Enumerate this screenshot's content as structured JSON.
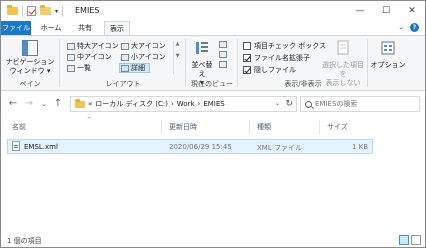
{
  "window": {
    "title": "EMIES",
    "qat_dropdown": "▾",
    "minimize": "—",
    "maximize": "☐",
    "close": "✕"
  },
  "tabs": {
    "file": "ファイル",
    "home": "ホーム",
    "share": "共有",
    "view": "表示",
    "collapse": "⌄",
    "help": "?"
  },
  "ribbon": {
    "panes": {
      "nav_pane_line1": "ナビゲーション",
      "nav_pane_line2": "ウィンドウ ▾",
      "label": "ペイン"
    },
    "layout": {
      "extra_large_icons": "特大アイコン",
      "large_icons": "大アイコン",
      "medium_icons": "中アイコン",
      "small_icons": "小アイコン",
      "list": "一覧",
      "details": "詳細",
      "label": "レイアウト"
    },
    "current_view": {
      "sort_by_line1": "並べ替え",
      "sort_by_line2": "▾",
      "label": "現在のビュー"
    },
    "show_hide": {
      "item_checkboxes": "項目チェック ボックス",
      "file_extensions": "ファイル名拡張子",
      "hidden_items": "隠しファイル",
      "hide_selected_line1": "選択した項目を",
      "hide_selected_line2": "表示しない",
      "label": "表示/非表示",
      "item_checkboxes_checked": false,
      "file_extensions_checked": true,
      "hidden_items_checked": true
    },
    "options": {
      "label": "オプション"
    }
  },
  "nav": {
    "back": "←",
    "forward": "→",
    "recent": "⌄",
    "up": "↑",
    "breadcrumb_prefix": "«",
    "breadcrumb": [
      "ローカル ディスク (C:)",
      "Work",
      "EMIES"
    ],
    "separator": "›",
    "address_dropdown": "⌄",
    "refresh": "↻",
    "search_placeholder": "EMIESの検索"
  },
  "columns": {
    "name": "名前",
    "modified": "更新日時",
    "type": "種類",
    "size": "サイズ",
    "sort_indicator": "^"
  },
  "files": [
    {
      "name": "EMSL.xml",
      "modified": "2020/06/29 15:45",
      "type": "XML ファイル",
      "size": "1 KB"
    }
  ],
  "status": {
    "count": "1 個の項目"
  }
}
